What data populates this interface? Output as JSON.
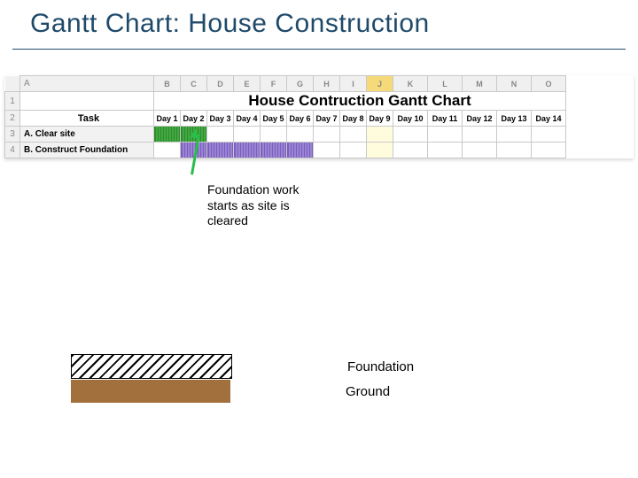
{
  "title": "Gantt Chart: House Construction",
  "spreadsheet": {
    "chart_title": "House Contruction Gantt Chart",
    "col_letters": [
      "A",
      "B",
      "C",
      "D",
      "E",
      "F",
      "G",
      "H",
      "I",
      "J",
      "K",
      "L",
      "M",
      "N",
      "O"
    ],
    "row_numbers": [
      "1",
      "2",
      "3",
      "4"
    ],
    "task_header": "Task",
    "day_headers": [
      "Day 1",
      "Day 2",
      "Day 3",
      "Day 4",
      "Day 5",
      "Day 6",
      "Day 7",
      "Day 8",
      "Day 9",
      "Day 10",
      "Day 11",
      "Day 12",
      "Day 13",
      "Day 14"
    ],
    "tasks": {
      "a": "A. Clear site",
      "b": "B. Construct Foundation"
    },
    "selected_col_index": 9
  },
  "callout": "Foundation work starts as site is cleared",
  "legend": {
    "foundation": "Foundation",
    "ground": "Ground"
  },
  "chart_data": {
    "type": "bar",
    "title": "House Contruction Gantt Chart",
    "xlabel": "Day",
    "ylabel": "Task",
    "categories": [
      "Day 1",
      "Day 2",
      "Day 3",
      "Day 4",
      "Day 5",
      "Day 6",
      "Day 7",
      "Day 8",
      "Day 9",
      "Day 10",
      "Day 11",
      "Day 12",
      "Day 13",
      "Day 14"
    ],
    "series": [
      {
        "name": "A. Clear site",
        "start": 1,
        "end": 2,
        "color": "green"
      },
      {
        "name": "B. Construct Foundation",
        "start": 2,
        "end": 6,
        "color": "purple"
      }
    ],
    "annotation": "Foundation work starts as site is cleared",
    "legend": [
      "Foundation",
      "Ground"
    ]
  }
}
